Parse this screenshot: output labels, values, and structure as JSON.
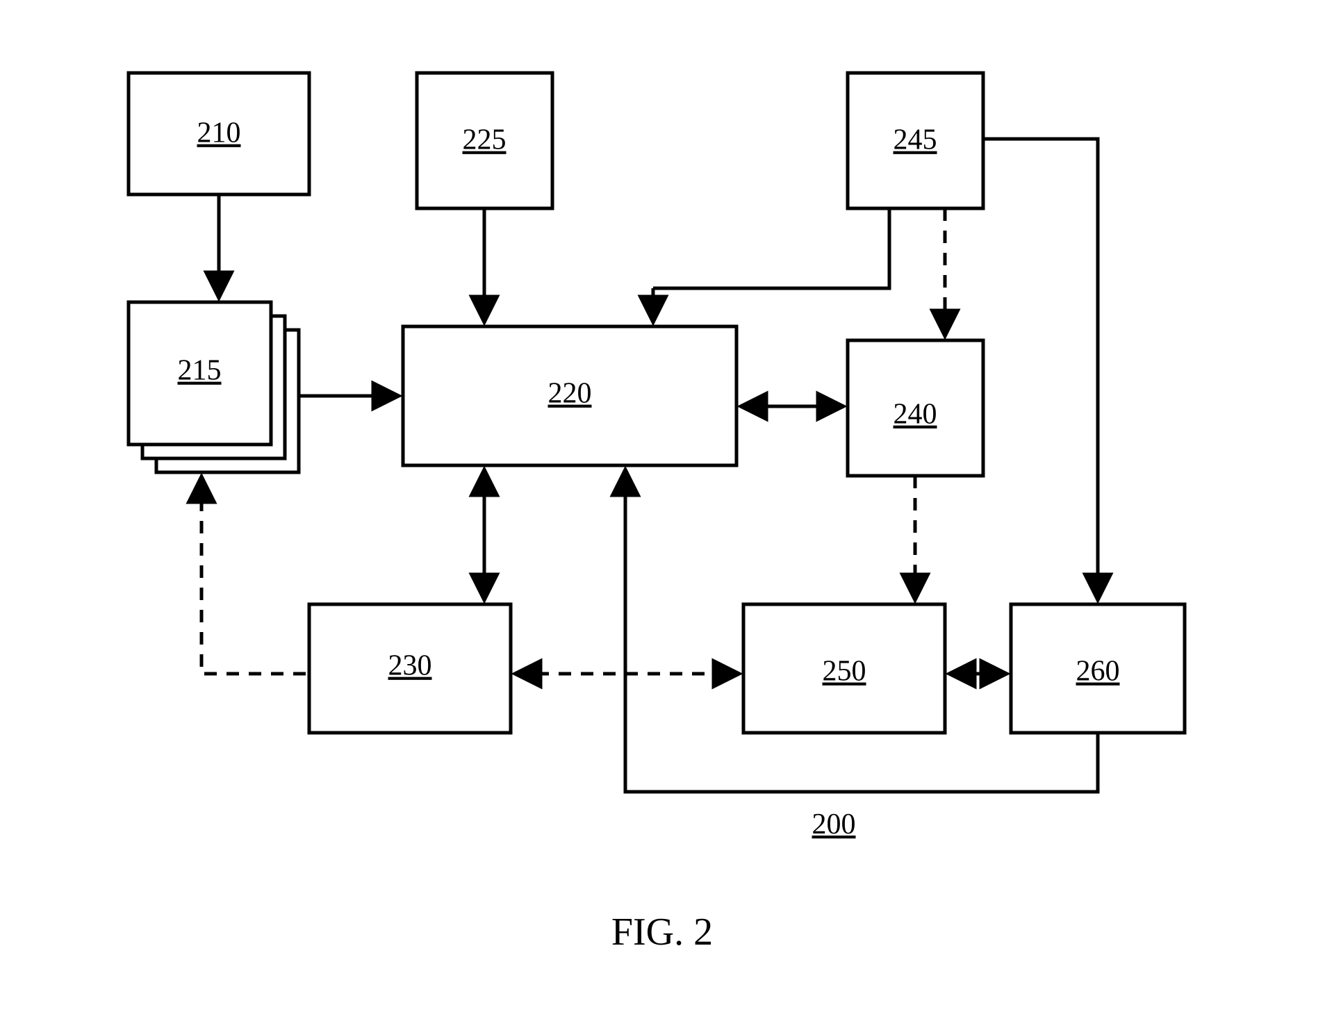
{
  "boxes": {
    "b210": "210",
    "b215": "215",
    "b225": "225",
    "b220": "220",
    "b245": "245",
    "b240": "240",
    "b230": "230",
    "b250": "250",
    "b260": "260"
  },
  "ref_label": "200",
  "figure_label": "FIG. 2"
}
